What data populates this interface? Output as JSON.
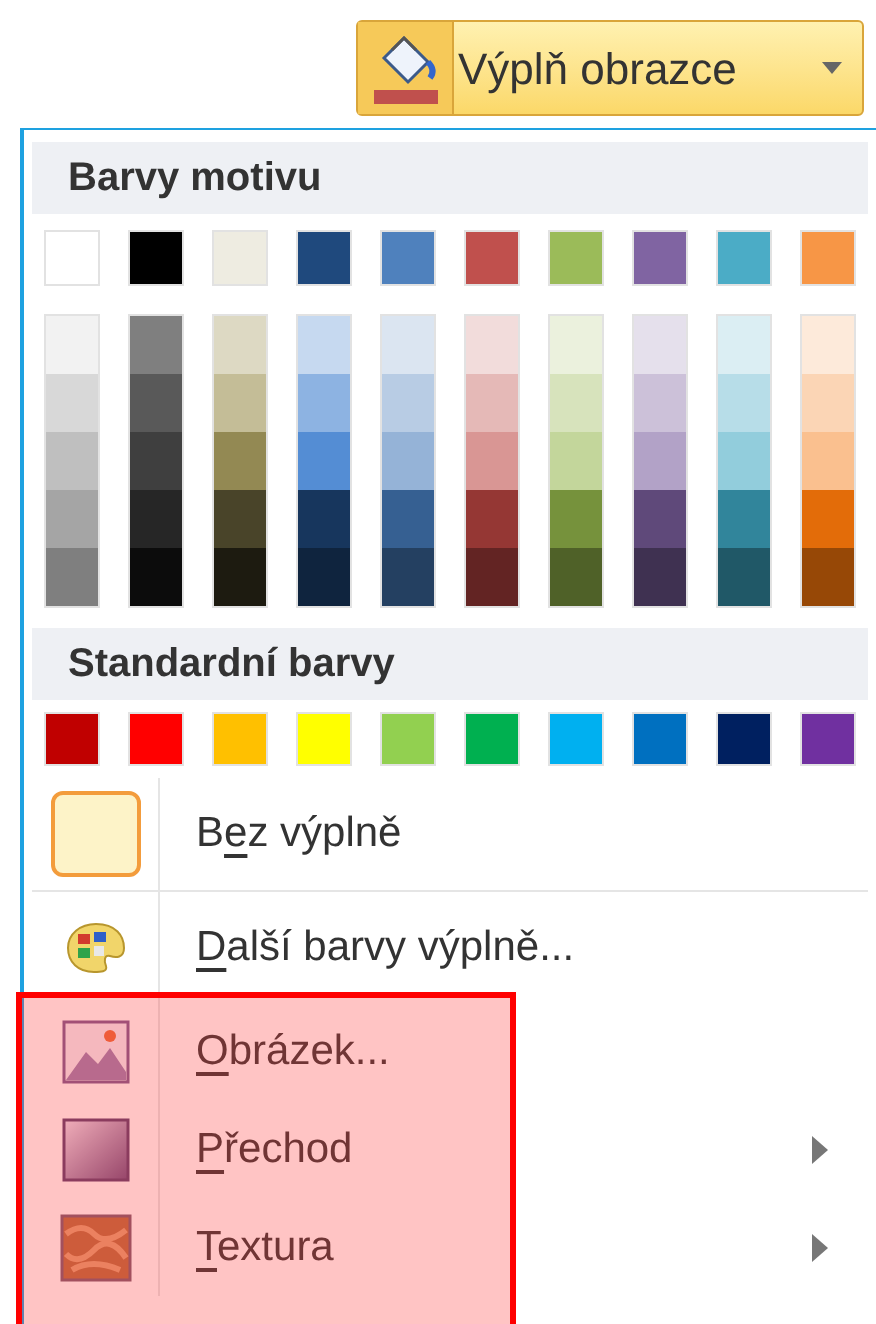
{
  "ribbon_button": {
    "label": "Výplň obrazce"
  },
  "theme_colors": {
    "title": "Barvy motivu",
    "columns": [
      {
        "color": "#ffffff",
        "shades": [
          {
            "color": "#f2f2f2"
          },
          {
            "color": "#d8d8d8"
          },
          {
            "color": "#bfbfbf"
          },
          {
            "color": "#a5a5a5"
          },
          {
            "color": "#7f7f7f"
          }
        ]
      },
      {
        "color": "#000000",
        "shades": [
          {
            "color": "#7f7f7f"
          },
          {
            "color": "#595959"
          },
          {
            "color": "#3f3f3f"
          },
          {
            "color": "#262626"
          },
          {
            "color": "#0c0c0c"
          }
        ]
      },
      {
        "color": "#eeece1",
        "shades": [
          {
            "color": "#ddd9c3"
          },
          {
            "color": "#c4bd97"
          },
          {
            "color": "#938953"
          },
          {
            "color": "#494429"
          },
          {
            "color": "#1d1b10"
          }
        ]
      },
      {
        "color": "#1f497d",
        "shades": [
          {
            "color": "#c6d9f0"
          },
          {
            "color": "#8db3e2"
          },
          {
            "color": "#548dd4"
          },
          {
            "color": "#17365d"
          },
          {
            "color": "#0f243e"
          }
        ]
      },
      {
        "color": "#4f81bd",
        "shades": [
          {
            "color": "#dbe5f1"
          },
          {
            "color": "#b8cce4"
          },
          {
            "color": "#95b3d7"
          },
          {
            "color": "#366092"
          },
          {
            "color": "#244061"
          }
        ]
      },
      {
        "color": "#c0504d",
        "shades": [
          {
            "color": "#f2dcdb"
          },
          {
            "color": "#e5b9b7"
          },
          {
            "color": "#d99694"
          },
          {
            "color": "#953734"
          },
          {
            "color": "#632423"
          }
        ]
      },
      {
        "color": "#9bbb59",
        "shades": [
          {
            "color": "#ebf1dd"
          },
          {
            "color": "#d7e3bc"
          },
          {
            "color": "#c3d69b"
          },
          {
            "color": "#76923c"
          },
          {
            "color": "#4f6128"
          }
        ]
      },
      {
        "color": "#8064a2",
        "shades": [
          {
            "color": "#e5e0ec"
          },
          {
            "color": "#ccc1d9"
          },
          {
            "color": "#b2a2c7"
          },
          {
            "color": "#5f497a"
          },
          {
            "color": "#3f3151"
          }
        ]
      },
      {
        "color": "#4bacc6",
        "shades": [
          {
            "color": "#dbeef3"
          },
          {
            "color": "#b7dde8"
          },
          {
            "color": "#92cddc"
          },
          {
            "color": "#31859b"
          },
          {
            "color": "#205867"
          }
        ]
      },
      {
        "color": "#f79646",
        "shades": [
          {
            "color": "#fdeada"
          },
          {
            "color": "#fbd5b5"
          },
          {
            "color": "#fac08f"
          },
          {
            "color": "#e36c09"
          },
          {
            "color": "#974806"
          }
        ]
      }
    ]
  },
  "standard_colors": {
    "title": "Standardní barvy",
    "swatches": [
      {
        "color": "#c00000"
      },
      {
        "color": "#ff0000"
      },
      {
        "color": "#ffc000"
      },
      {
        "color": "#ffff00"
      },
      {
        "color": "#92d050"
      },
      {
        "color": "#00b050"
      },
      {
        "color": "#00b0f0"
      },
      {
        "color": "#0070c0"
      },
      {
        "color": "#002060"
      },
      {
        "color": "#7030a0"
      }
    ]
  },
  "menu_items": [
    {
      "kind": "no-fill",
      "label_before": "B",
      "access_key": "e",
      "label_after": "z výplně",
      "has_submenu": false,
      "highlighted": false
    },
    {
      "kind": "more-colors",
      "access_key": "D",
      "label_after": "alší barvy výplně...",
      "has_submenu": false,
      "highlighted": false
    },
    {
      "kind": "picture",
      "access_key": "O",
      "label_after": "brázek...",
      "has_submenu": false,
      "highlighted": true
    },
    {
      "kind": "gradient",
      "access_key": "P",
      "label_after": "řechod",
      "has_submenu": true,
      "highlighted": true
    },
    {
      "kind": "texture",
      "access_key": "T",
      "label_after": "extura",
      "has_submenu": true,
      "highlighted": true
    }
  ]
}
